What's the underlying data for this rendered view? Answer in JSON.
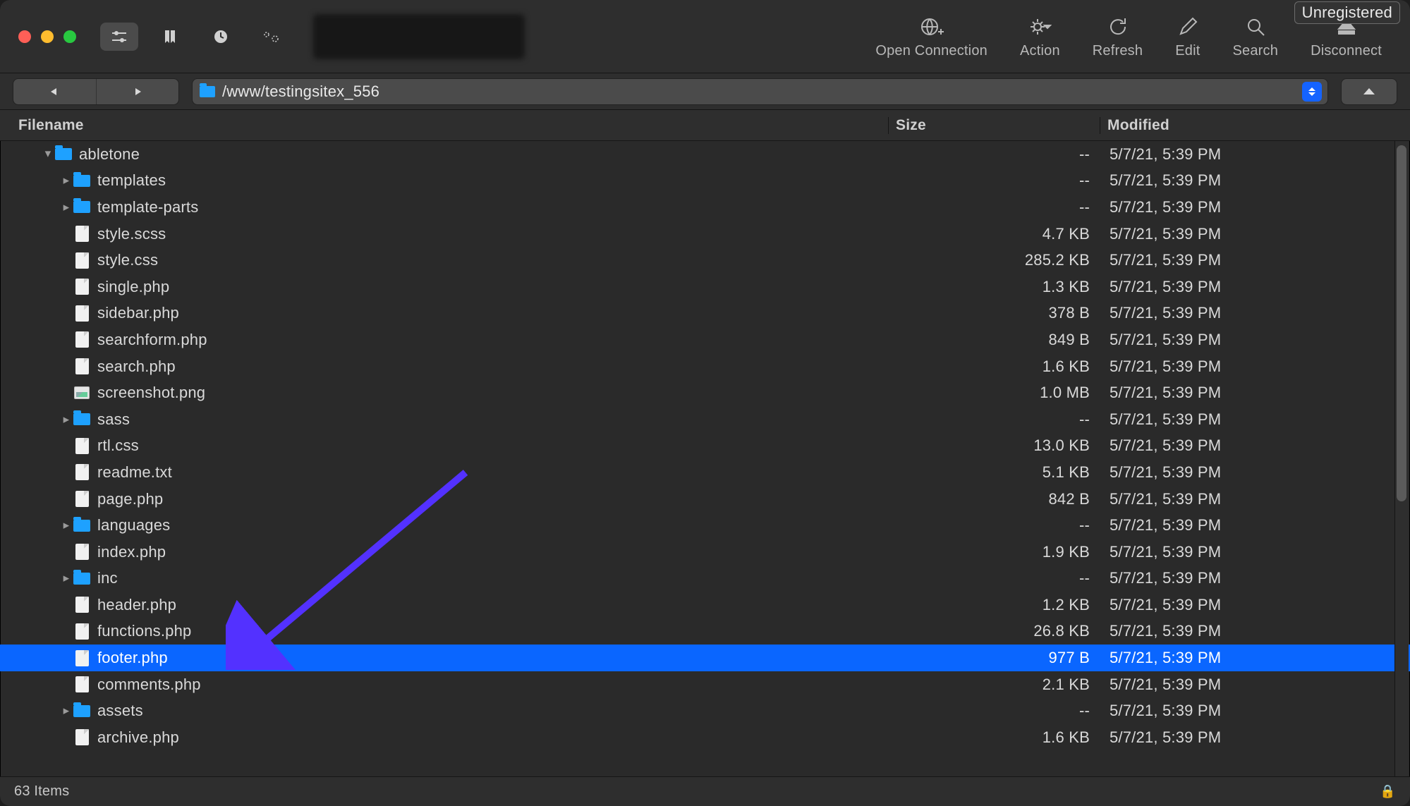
{
  "badge": {
    "unregistered": "Unregistered"
  },
  "toolbar": {
    "open_connection": "Open Connection",
    "action": "Action",
    "refresh": "Refresh",
    "edit": "Edit",
    "search": "Search",
    "disconnect": "Disconnect"
  },
  "path": "/www/testingsitex_556",
  "columns": {
    "filename": "Filename",
    "size": "Size",
    "modified": "Modified"
  },
  "modified_common": "5/7/21, 5:39 PM",
  "rows": [
    {
      "name": "abletone",
      "kind": "folder",
      "indent": 0,
      "disclosure": "open",
      "size": "--",
      "selected": false
    },
    {
      "name": "templates",
      "kind": "folder",
      "indent": 1,
      "disclosure": "closed",
      "size": "--",
      "selected": false
    },
    {
      "name": "template-parts",
      "kind": "folder",
      "indent": 1,
      "disclosure": "closed",
      "size": "--",
      "selected": false
    },
    {
      "name": "style.scss",
      "kind": "file",
      "indent": 1,
      "disclosure": "none",
      "size": "4.7 KB",
      "selected": false
    },
    {
      "name": "style.css",
      "kind": "file",
      "indent": 1,
      "disclosure": "none",
      "size": "285.2 KB",
      "selected": false
    },
    {
      "name": "single.php",
      "kind": "file",
      "indent": 1,
      "disclosure": "none",
      "size": "1.3 KB",
      "selected": false
    },
    {
      "name": "sidebar.php",
      "kind": "file",
      "indent": 1,
      "disclosure": "none",
      "size": "378 B",
      "selected": false
    },
    {
      "name": "searchform.php",
      "kind": "file",
      "indent": 1,
      "disclosure": "none",
      "size": "849 B",
      "selected": false
    },
    {
      "name": "search.php",
      "kind": "file",
      "indent": 1,
      "disclosure": "none",
      "size": "1.6 KB",
      "selected": false
    },
    {
      "name": "screenshot.png",
      "kind": "image",
      "indent": 1,
      "disclosure": "none",
      "size": "1.0 MB",
      "selected": false
    },
    {
      "name": "sass",
      "kind": "folder",
      "indent": 1,
      "disclosure": "closed",
      "size": "--",
      "selected": false
    },
    {
      "name": "rtl.css",
      "kind": "file",
      "indent": 1,
      "disclosure": "none",
      "size": "13.0 KB",
      "selected": false
    },
    {
      "name": "readme.txt",
      "kind": "file",
      "indent": 1,
      "disclosure": "none",
      "size": "5.1 KB",
      "selected": false
    },
    {
      "name": "page.php",
      "kind": "file",
      "indent": 1,
      "disclosure": "none",
      "size": "842 B",
      "selected": false
    },
    {
      "name": "languages",
      "kind": "folder",
      "indent": 1,
      "disclosure": "closed",
      "size": "--",
      "selected": false
    },
    {
      "name": "index.php",
      "kind": "file",
      "indent": 1,
      "disclosure": "none",
      "size": "1.9 KB",
      "selected": false
    },
    {
      "name": "inc",
      "kind": "folder",
      "indent": 1,
      "disclosure": "closed",
      "size": "--",
      "selected": false
    },
    {
      "name": "header.php",
      "kind": "file",
      "indent": 1,
      "disclosure": "none",
      "size": "1.2 KB",
      "selected": false
    },
    {
      "name": "functions.php",
      "kind": "file",
      "indent": 1,
      "disclosure": "none",
      "size": "26.8 KB",
      "selected": false
    },
    {
      "name": "footer.php",
      "kind": "file",
      "indent": 1,
      "disclosure": "none",
      "size": "977 B",
      "selected": true
    },
    {
      "name": "comments.php",
      "kind": "file",
      "indent": 1,
      "disclosure": "none",
      "size": "2.1 KB",
      "selected": false
    },
    {
      "name": "assets",
      "kind": "folder",
      "indent": 1,
      "disclosure": "closed",
      "size": "--",
      "selected": false
    },
    {
      "name": "archive.php",
      "kind": "file",
      "indent": 1,
      "disclosure": "none",
      "size": "1.6 KB",
      "selected": false
    }
  ],
  "status": {
    "items": "63 Items"
  },
  "scroll": {
    "thumb_height_pct": 56
  },
  "annotation": {
    "arrow_color": "#5331ff"
  }
}
